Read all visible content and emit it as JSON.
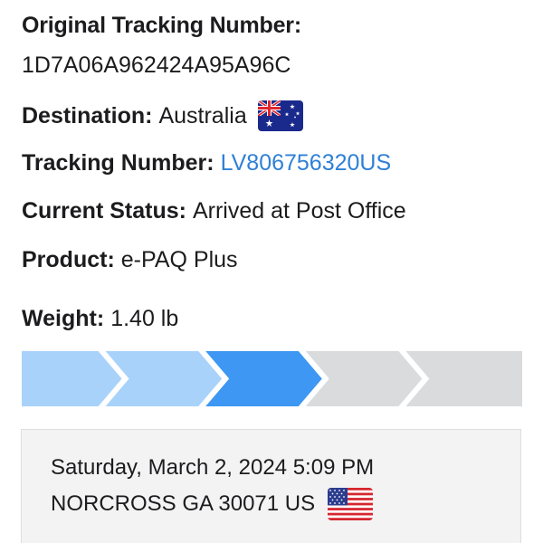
{
  "header": {
    "title": "Original Tracking Number:",
    "original_tracking_number": "1D7A06A962424A95A96C"
  },
  "details": {
    "destination_label": "Destination:",
    "destination_value": "Australia",
    "destination_flag_icon": "australia-flag-icon",
    "tracking_label": "Tracking Number:",
    "tracking_value": "LV806756320US",
    "status_label": "Current Status:",
    "status_value": "Arrived at Post Office",
    "product_label": "Product:",
    "product_value": "e-PAQ Plus",
    "weight_label": "Weight:",
    "weight_value": "1.40 lb"
  },
  "progress": {
    "total_steps": 5,
    "current_step": 3,
    "colors": {
      "completed": "#a9d2fb",
      "current": "#3d97f3",
      "pending": "#d9dbdd"
    }
  },
  "event": {
    "datetime": "Saturday, March 2, 2024 5:09 PM",
    "location": "NORCROSS GA 30071 US",
    "flag_icon": "usa-flag-icon"
  }
}
